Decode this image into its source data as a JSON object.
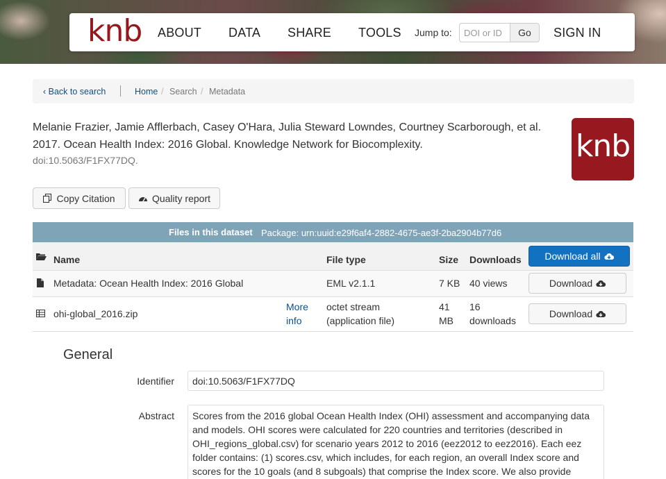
{
  "nav": {
    "brand": "knb",
    "links": [
      "ABOUT",
      "DATA",
      "SHARE",
      "TOOLS"
    ],
    "jump_label": "Jump to:",
    "jump_placeholder": "DOI or ID",
    "go_label": "Go",
    "sign_in": "SIGN IN"
  },
  "breadcrumb": {
    "back": "Back to search",
    "home": "Home",
    "search": "Search",
    "current": "Metadata"
  },
  "citation": {
    "text": "Melanie Frazier, Jamie Afflerbach, Casey O'Hara, Julia Steward Lowndes, Courtney Scarborough, et al. 2017. Ocean Health Index: 2016 Global. Knowledge Network for Biocomplexity.",
    "doi": "doi:10.5063/F1FX77DQ.",
    "logo": "knb"
  },
  "actions": {
    "copy_citation": "Copy Citation",
    "quality_report": "Quality report"
  },
  "files": {
    "title": "Files in this dataset",
    "package": "Package: urn:uuid:e29f6af4-2882-4675-ae3f-2ba2904b77d6",
    "headers": {
      "name": "Name",
      "file_type": "File type",
      "size": "Size",
      "downloads": "Downloads"
    },
    "download_all": "Download all",
    "rows": [
      {
        "name": "Metadata: Ocean Health Index: 2016 Global",
        "more_info": "",
        "type_line1": "EML v2.1.1",
        "type_line2": "",
        "size_line1": "7 KB",
        "size_line2": "",
        "downloads_line1": "40 views",
        "downloads_line2": "",
        "download": "Download"
      },
      {
        "name": "ohi-global_2016.zip",
        "more_info_line1": "More",
        "more_info_line2": "info",
        "type_line1": "octet stream",
        "type_line2": "(application file)",
        "size_line1": "41",
        "size_line2": "MB",
        "downloads_line1": "16",
        "downloads_line2": "downloads",
        "download": "Download"
      }
    ]
  },
  "general": {
    "heading": "General",
    "identifier_label": "Identifier",
    "identifier_value": "doi:10.5063/F1FX77DQ",
    "abstract_label": "Abstract",
    "abstract_value": "Scores from the 2016 global Ocean Health Index (OHI) assessment and accompanying data and models. OHI scores were calculated for 220 countries and territories (described in OHI_regions_global.csv) for scenario years 2012 to 2016 (eez2012 to eez2016). Each eez folder contains: (1) scores.csv, which includes, for each region, an overall Index score and scores for the 10 goals (and 8 subgoals) that comprise the Index score. We also provide"
  },
  "colors": {
    "brand": "#96181c",
    "link": "#0d4f8b",
    "primary_button": "#1371c2",
    "files_header": "#7fa4b7"
  }
}
